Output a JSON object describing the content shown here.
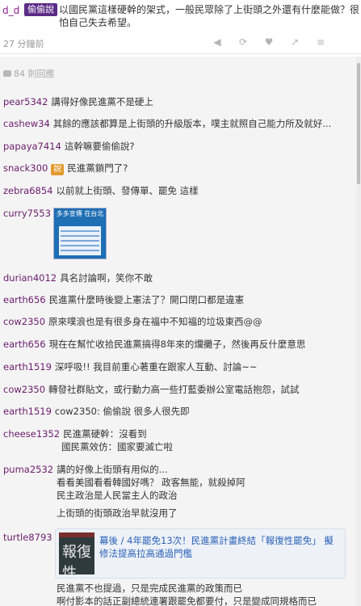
{
  "post": {
    "user": "d_d",
    "badge": "偷偷說",
    "text": "以國民黨這樣硬幹的架式，一般民眾除了上街頭之外還有什麼能做？很怕自己失去希望。",
    "time": "27 分鐘前",
    "icons": [
      "mute-icon",
      "repost-icon",
      "heart-icon",
      "share-icon",
      "menu-icon"
    ]
  },
  "replies_header": "84 則回應",
  "comments": [
    {
      "user": "pear5342",
      "text": "講得好像民進黨不是硬上"
    },
    {
      "user": "cashew34",
      "text": "其餘的應該都算是上街頭的升級版本，噗主就照自己能力所及就好..."
    },
    {
      "user": "papaya7414",
      "text": "這幹嘛要偷偷說?"
    },
    {
      "user": "snack300",
      "badge": "說",
      "text": "民進黨鎖門了?"
    },
    {
      "user": "zebra6854",
      "text": "以前就上街頭、發傳單、罷免 這樣"
    },
    {
      "user": "curry7553",
      "text": ""
    },
    {
      "user": "durian4012",
      "text": "具名討論啊，笑你不敢"
    },
    {
      "user": "earth656",
      "text": "民進黨什麼時後變上憲法了？開口閉口都是違憲"
    },
    {
      "user": "cow2350",
      "text": "原來噗浪也是有很多身在福中不知福的垃圾東西@@"
    },
    {
      "user": "earth656",
      "text": "現在在幫忙收拾民進黨搞得8年來的爛攤子，然後再反什麼意思"
    },
    {
      "user": "earth1519",
      "text": "深呼吸!! 我目前重心著重在跟家人互動、討論~~"
    },
    {
      "user": "cow2350",
      "text": "轉發社群貼文，或行動力高一些打藍委辦公室電話抱怨，試試"
    },
    {
      "user": "earth1519",
      "text": "cow2350: 偷偷說 很多人很先即"
    },
    {
      "user": "cheese1352",
      "text": "民進黨硬幹：沒看到"
    },
    {
      "user": "puma2532",
      "text": "講的好像上街頭有用似的..."
    },
    {
      "user": "turtle8793",
      "text": ""
    }
  ],
  "thumb": {
    "title": "多多宣傳 在台北"
  },
  "cheese_extra": "國民黨效仿：國家要滅亡啦",
  "puma_extra": [
    "看看美國看看韓國好嗎？ 政客無能，就殺掉阿",
    "民主政治是人民當主人的政治",
    "上街頭的街頭政治早就沒用了"
  ],
  "link_card": {
    "title": "幕後 / 4年罷免13次！民進黨計畫終結「報復性罷免」 擬修法提高拉高通過門檻",
    "thumb_text": "報復性"
  },
  "turtle_extra": [
    "民進黨不也提過，只是完成民進黨的政策而已",
    "啊付影本的話正副總統連署跟罷免都要付，只是變成同規格而已"
  ],
  "colors": {
    "user": "#6b1c6d",
    "badge": "#5b2a86",
    "orange": "#e39a2e",
    "link": "#2b62b7"
  }
}
